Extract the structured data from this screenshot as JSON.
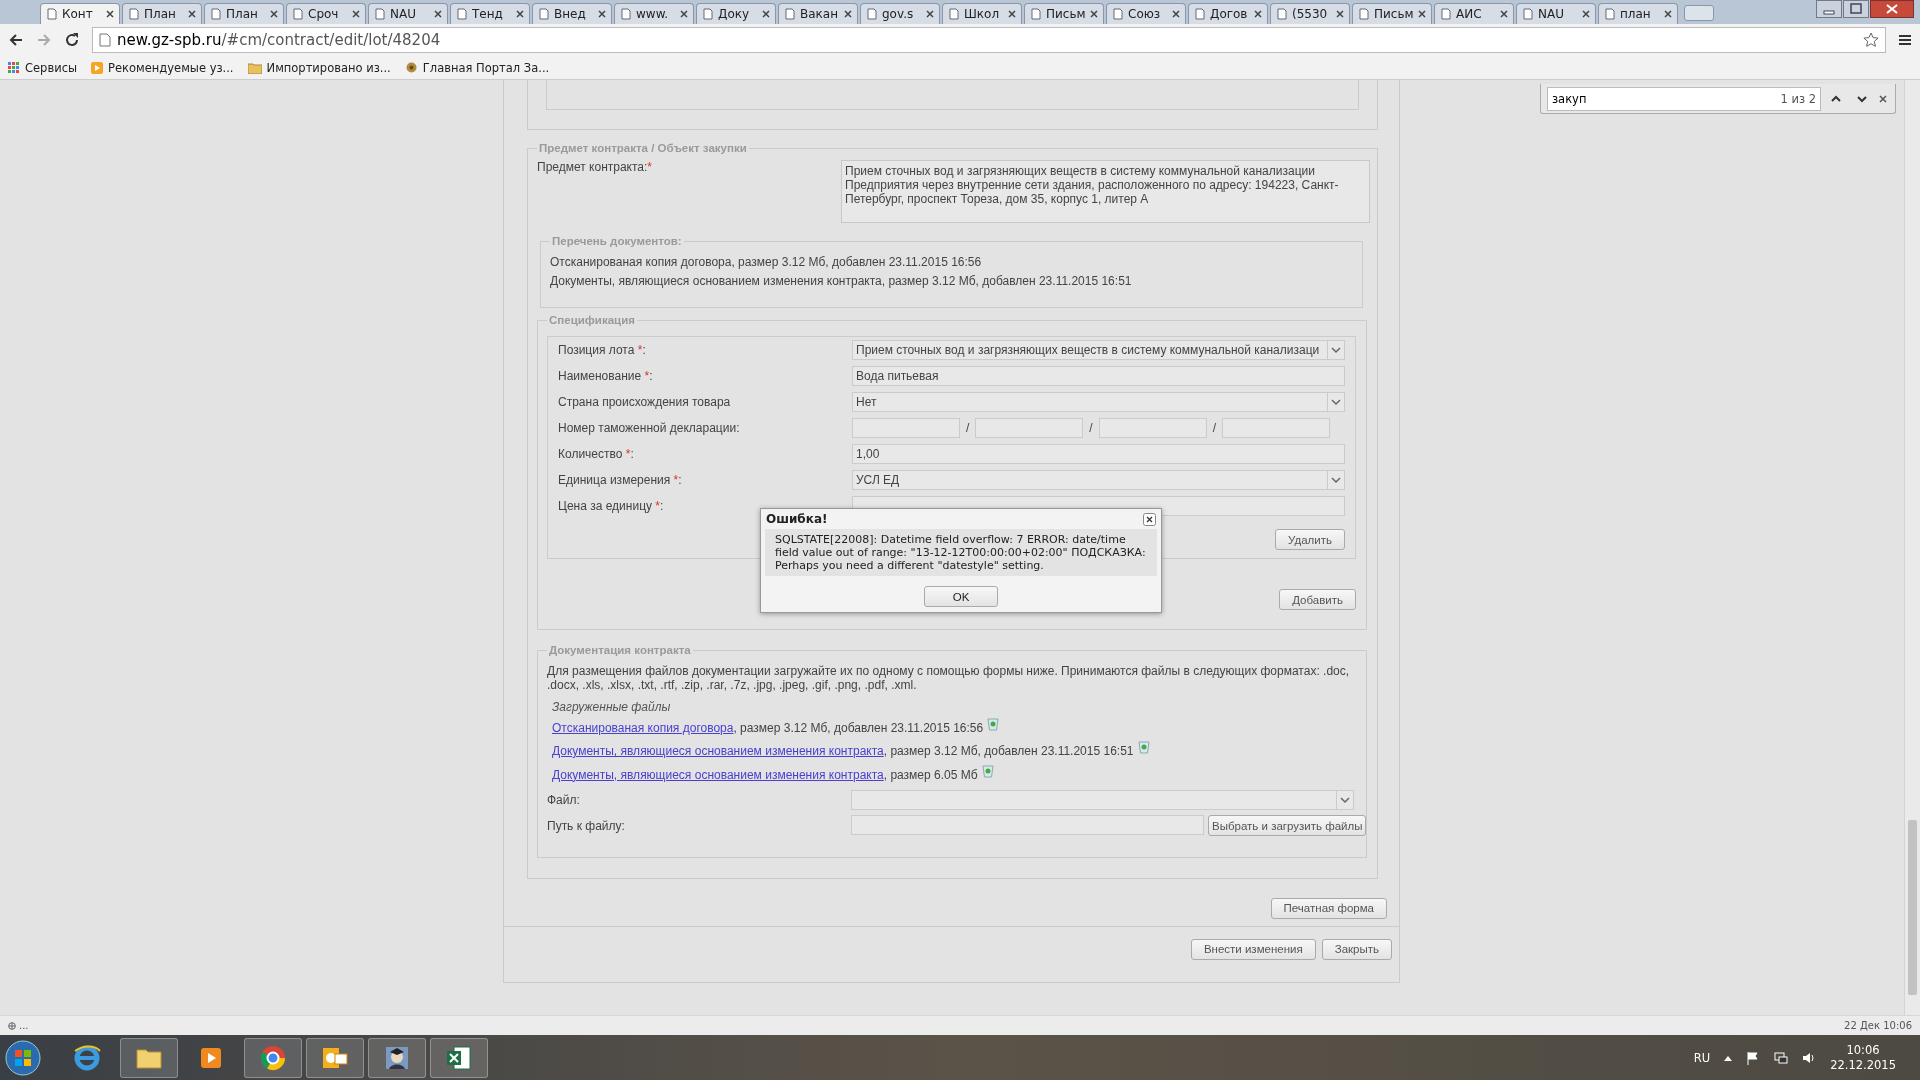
{
  "browser": {
    "tabs": [
      {
        "label": "Конт",
        "selected": true
      },
      {
        "label": "План",
        "selected": false
      },
      {
        "label": "План",
        "selected": false
      },
      {
        "label": "Сроч",
        "selected": false
      },
      {
        "label": "NAU",
        "selected": false
      },
      {
        "label": "Тенд",
        "selected": false
      },
      {
        "label": "Внед",
        "selected": false
      },
      {
        "label": "www.",
        "selected": false
      },
      {
        "label": "Доку",
        "selected": false
      },
      {
        "label": "Вакан",
        "selected": false
      },
      {
        "label": "gov.s",
        "selected": false
      },
      {
        "label": "Школ",
        "selected": false
      },
      {
        "label": "Письм",
        "selected": false
      },
      {
        "label": "Союз",
        "selected": false
      },
      {
        "label": "Догов",
        "selected": false
      },
      {
        "label": "(5530",
        "selected": false
      },
      {
        "label": "Письм",
        "selected": false
      },
      {
        "label": "АИС",
        "selected": false
      },
      {
        "label": "NAU",
        "selected": false
      },
      {
        "label": "план",
        "selected": false
      }
    ],
    "address": {
      "host": "new.gz-spb.ru",
      "path": "/#cm/contract/edit/lot/48204"
    },
    "bookmarks": [
      "Сервисы",
      "Рекомендуемые уз...",
      "Импортировано из...",
      "Главная Портал За..."
    ]
  },
  "find_bar": {
    "query": "закуп",
    "count": "1 из 2"
  },
  "subject": {
    "legend": "Предмет контракта / Объект закупки",
    "label": "Предмет контракта:",
    "mark": "*",
    "value": "Прием сточных вод и загрязняющих веществ в систему коммунальной канализации Предприятия через внутренние сети здания, расположенного по адресу: 194223, Санкт-Петербург, проспект Тореза, дом 35, корпус 1, литер А"
  },
  "documents": {
    "legend": "Перечень документов:",
    "items": [
      "Отсканированая копия договора, размер 3.12 Мб, добавлен 23.11.2015 16:56",
      "Документы, являющиеся основанием изменения контракта, размер 3.12 Мб, добавлен 23.11.2015 16:51"
    ]
  },
  "specification": {
    "legend": "Спецификация",
    "fields": [
      {
        "kind": "select",
        "label": "Позиция лота ",
        "mark": "*",
        "suffix": ":",
        "value": "Прием сточных вод и загрязняющих веществ в систему коммунальной канализаци"
      },
      {
        "kind": "text",
        "label": "Наименование ",
        "mark": "*",
        "suffix": ":",
        "value": "Вода питьевая"
      },
      {
        "kind": "select",
        "label": "Страна происхождения товара",
        "value": "Нет"
      },
      {
        "kind": "customs",
        "label": "Номер таможенной декларации:",
        "separators": [
          "/",
          "/",
          "/"
        ]
      },
      {
        "kind": "text",
        "label": "Количество ",
        "mark": "*",
        "suffix": ":",
        "value": "1,00"
      },
      {
        "kind": "select",
        "label": "Единица измерения ",
        "mark": "*",
        "suffix": ":",
        "value": "УСЛ ЕД"
      },
      {
        "kind": "text",
        "label": "Цена за единицу ",
        "mark": "*",
        "suffix": ":"
      }
    ],
    "delete_button": "Удалить",
    "add_button": "Добавить"
  },
  "contract_docs": {
    "legend": "Документация контракта",
    "intro": "Для размещения файлов документации загружайте их по одному с помощью формы ниже. Принимаются файлы в следующих форматах: .doc, .docx, .xls, .xlsx, .txt, .rtf, .zip, .rar, .7z, .jpg, .jpeg, .gif, .png, .pdf, .xml.",
    "uploaded_title": "Загруженные файлы",
    "files": [
      {
        "link": "Отсканированая копия договора",
        "info": ", размер 3.12 Мб, добавлен 23.11.2015 16:56"
      },
      {
        "link": "Документы, являющиеся основанием изменения контракта",
        "info": ", размер 3.12 Мб, добавлен 23.11.2015 16:51"
      },
      {
        "link": "Документы, являющиеся основанием изменения контракта",
        "info": ", размер 6.05 Мб"
      }
    ],
    "file_label": "Файл:",
    "path_label": "Путь к файлу:",
    "upload_button": "Выбрать и загрузить файлы"
  },
  "print_button": "Печатная форма",
  "actions": [
    "Внести изменения",
    "Закрыть"
  ],
  "dialog": {
    "title": "Ошибка!",
    "message": "SQLSTATE[22008]: Datetime field overflow: 7 ERROR: date/time field value out of range: \"13-12-12T00:00:00+02:00\" ПОДСКАЗКА: Perhaps you need a different \"datestyle\" setting.",
    "button": "OK"
  },
  "status_bar": {
    "left": "...",
    "right": "22 Дек 10:06"
  },
  "taskbar": {
    "language": "RU",
    "time": "10:06",
    "date": "22.12.2015"
  }
}
